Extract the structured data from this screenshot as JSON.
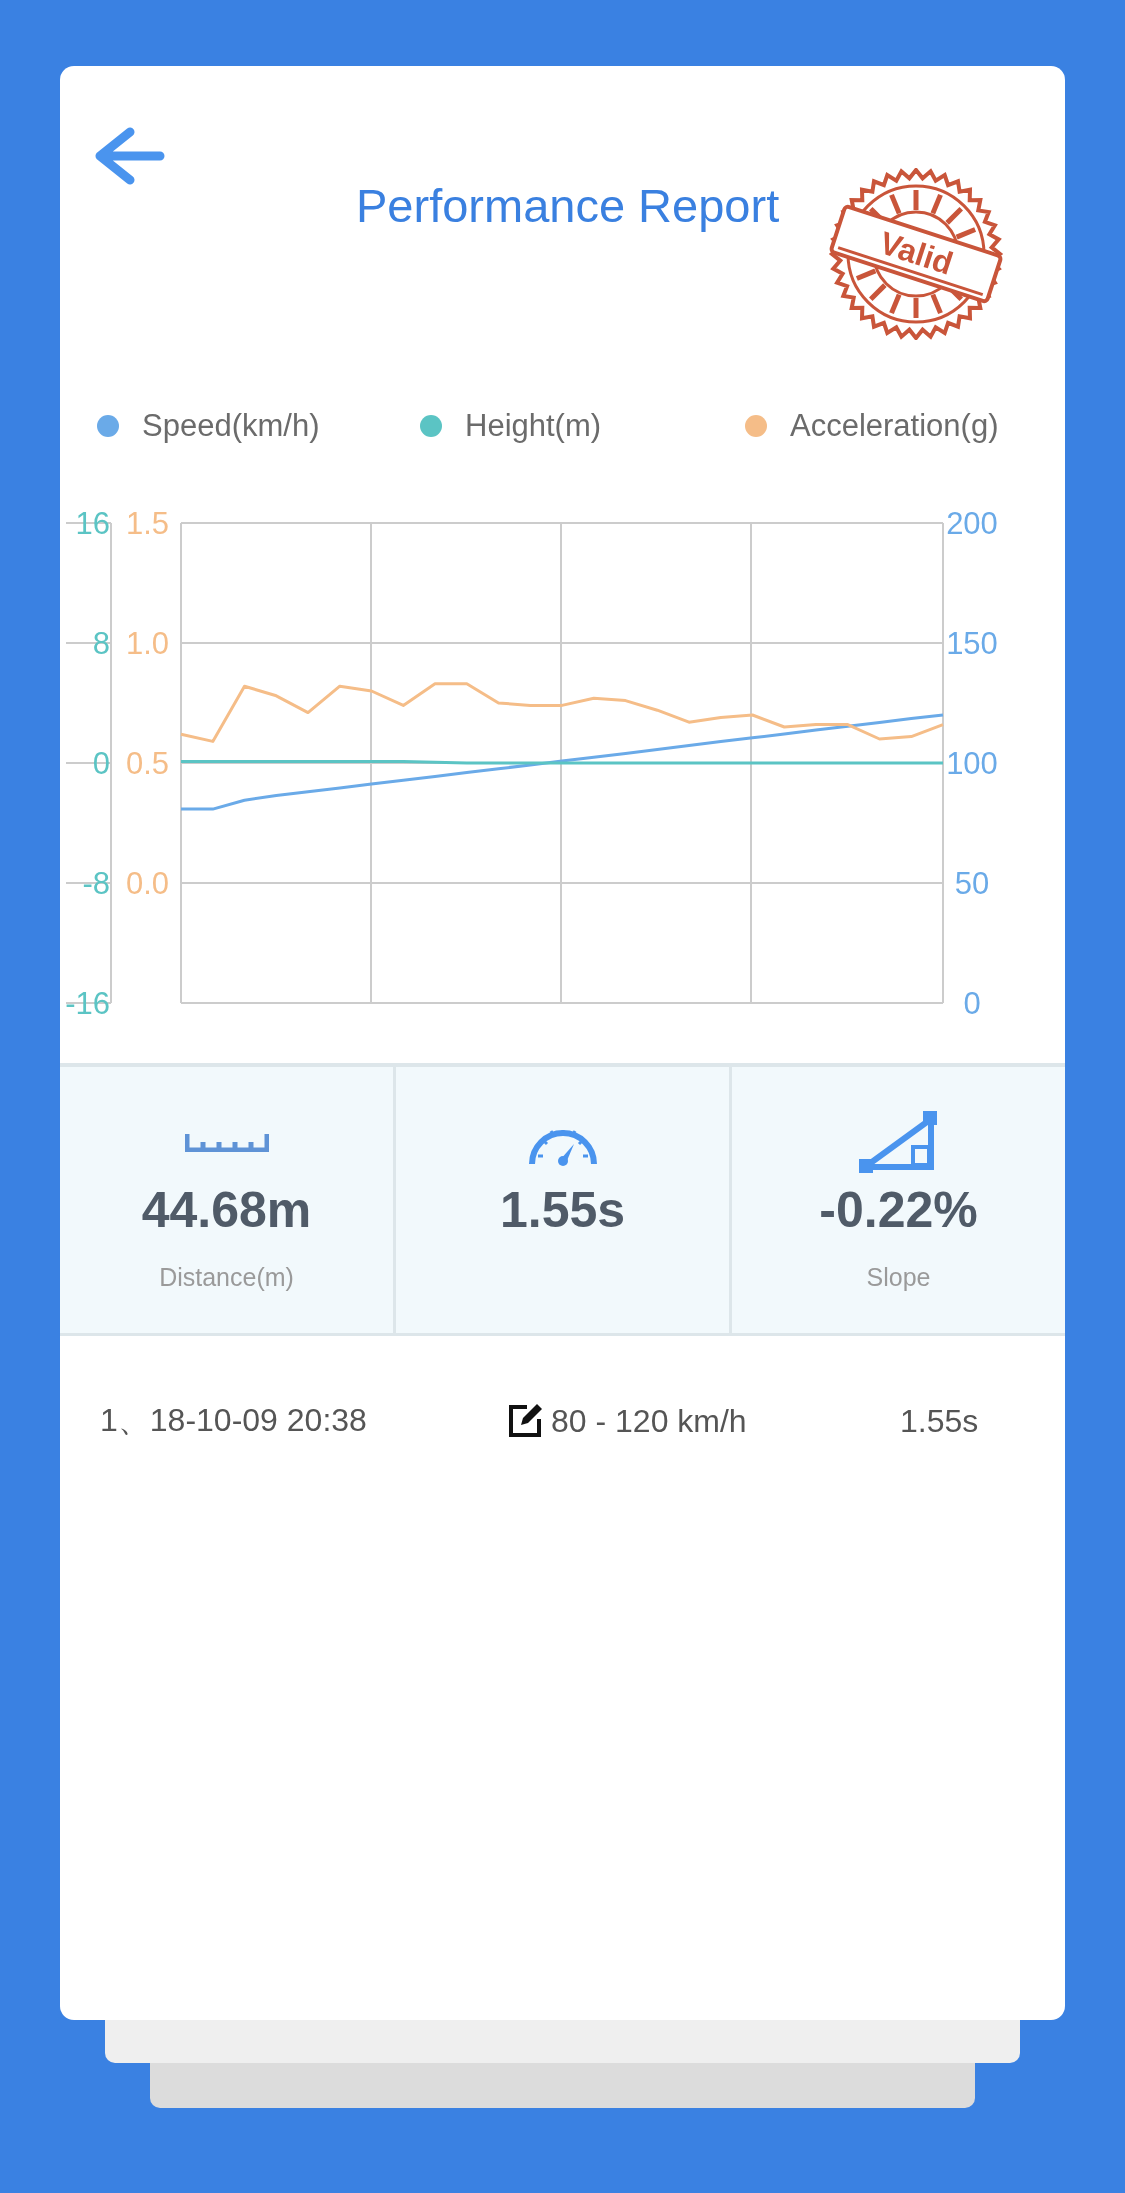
{
  "header": {
    "title": "Performance Report",
    "stamp": "Valid"
  },
  "charts": [
    {
      "chart_data": {
        "type": "line",
        "categories": [
          null,
          null,
          null,
          null,
          null,
          null,
          null,
          null,
          null,
          null,
          null,
          null,
          null,
          null,
          null,
          null,
          null,
          null,
          null,
          null,
          null,
          null,
          null,
          null,
          null
        ],
        "grid": true,
        "ylim": [
          0,
          200
        ],
        "yticks": [
          200,
          150,
          100,
          50,
          0
        ],
        "series": [
          {
            "name": "Speed(km/h)",
            "color": "#6aaae8",
            "values": [
              80.8,
              80.8,
              84.5,
              86.4,
              88,
              89.6,
              91.2,
              92.8,
              94.4,
              96,
              97.6,
              99.2,
              100.8,
              102.4,
              104,
              105.6,
              107.3,
              108.9,
              110.5,
              112.1,
              113.7,
              115.3,
              116.9,
              118.5,
              120
            ]
          }
        ]
      }
    },
    {
      "chart_data": {
        "type": "line",
        "categories": [
          null,
          null,
          null,
          null,
          null,
          null,
          null,
          null,
          null,
          null,
          null,
          null,
          null,
          null,
          null,
          null,
          null,
          null,
          null,
          null,
          null,
          null,
          null,
          null,
          null
        ],
        "ylim": [
          -16,
          16
        ],
        "yticks": [
          16,
          8,
          0,
          -8,
          -16
        ],
        "series": [
          {
            "name": "Height(m)",
            "color": "#5bc4c4",
            "values": [
              0.1,
              0.1,
              0.1,
              0.1,
              0.1,
              0.1,
              0.1,
              0.1,
              0.05,
              0,
              0,
              0,
              0,
              0,
              0,
              0,
              0,
              0,
              0,
              0,
              0,
              0,
              0,
              0,
              0
            ]
          }
        ]
      }
    },
    {
      "chart_data": {
        "type": "line",
        "categories": [
          null,
          null,
          null,
          null,
          null,
          null,
          null,
          null,
          null,
          null,
          null,
          null,
          null,
          null,
          null,
          null,
          null,
          null,
          null,
          null,
          null,
          null,
          null,
          null,
          null
        ],
        "ylim": [
          0,
          1.5
        ],
        "yticks": [
          1.5,
          {
            "value": 1,
            "label": "1.0"
          },
          0.5,
          {
            "value": 0,
            "label": "0.0"
          }
        ],
        "series": [
          {
            "name": "Acceleration(g)",
            "color": "#f5bd88",
            "values": [
              0.62,
              0.59,
              0.82,
              0.78,
              0.71,
              0.82,
              0.8,
              0.74,
              0.83,
              0.83,
              0.75,
              0.74,
              0.74,
              0.77,
              0.76,
              0.72,
              0.67,
              0.69,
              0.7,
              0.65,
              0.66,
              0.66,
              0.6,
              0.61,
              0.66
            ]
          }
        ]
      }
    }
  ],
  "stats": [
    {
      "value": "44.68m",
      "label": "Distance(m)"
    },
    {
      "value": "1.55s"
    },
    {
      "value": "-0.22%",
      "label": "Slope"
    }
  ],
  "records": [
    {
      "date": "1、18-10-09 20:38",
      "range": "80 - 120 km/h",
      "time": "1.55s"
    }
  ]
}
